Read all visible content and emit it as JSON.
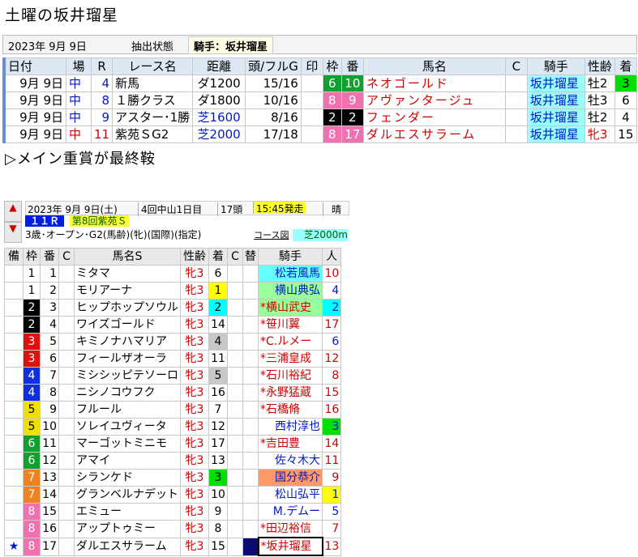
{
  "page_title": "土曜の坂井瑠星",
  "subtitle": "▷メイン重賞が最終鞍",
  "filter": {
    "date": "2023年 9月 9日",
    "label": "抽出状態",
    "condition": "騎手：坂井瑠星"
  },
  "summary": {
    "headers": [
      "日付",
      "場",
      "R",
      "レース名",
      "距離",
      "頭/フルG",
      "印",
      "枠",
      "番",
      "馬名",
      "C",
      "騎手",
      "性齢",
      "着"
    ],
    "rows": [
      {
        "date": "9月 9日",
        "place": "中",
        "r": "4",
        "race": "新馬",
        "dist": "ダ1200",
        "heads": "15/16",
        "mark": "",
        "waku": "6",
        "ban": "10",
        "horse": "ネオゴールド",
        "c": "",
        "jockey": "坂井瑠星",
        "sex": "牡2",
        "finish": "3"
      },
      {
        "date": "9月 9日",
        "place": "中",
        "r": "8",
        "race": "１勝クラス",
        "dist": "ダ1800",
        "heads": "10/16",
        "mark": "",
        "waku": "8",
        "ban": "9",
        "horse": "アヴァンタージュ",
        "c": "",
        "jockey": "坂井瑠星",
        "sex": "牡3",
        "finish": "6"
      },
      {
        "date": "9月 9日",
        "place": "中",
        "r": "9",
        "race": "アスター･1勝",
        "dist": "芝1600",
        "heads": "8/16",
        "mark": "",
        "waku": "2",
        "ban": "2",
        "horse": "フェンダー",
        "c": "",
        "jockey": "坂井瑠星",
        "sex": "牡2",
        "finish": "4"
      },
      {
        "date": "9月 9日",
        "place": "中",
        "r": "11",
        "race": "紫苑ＳG2",
        "dist": "芝2000",
        "heads": "17/18",
        "mark": "",
        "waku": "8",
        "ban": "17",
        "horse": "ダルエスサラーム",
        "c": "",
        "jockey": "坂井瑠星",
        "sex": "牝3",
        "finish": "15"
      }
    ]
  },
  "racecard": {
    "date": "2023年 9月 9日(土)",
    "kaisai": "4回中山1日目",
    "heads": "17頭",
    "start": "15:45発走",
    "weather": "晴",
    "race_no": "１１Ｒ",
    "race_name": "第8回紫苑Ｓ",
    "condition": "3歳･オープン･G2(馬齢)(牝)(国際)(指定)",
    "course_link": "コース図",
    "course": "芝2000m",
    "headers": [
      "備",
      "枠",
      "番",
      "C",
      "馬名S",
      "性齢",
      "着",
      "C",
      "替",
      "騎手",
      "人"
    ],
    "rows": [
      {
        "mark": "",
        "waku": "1",
        "ban": "1",
        "horse": "ミタマ",
        "sex": "牝3",
        "finish": "6",
        "jockey": "松若風馬",
        "change": "",
        "pop": "10"
      },
      {
        "mark": "",
        "waku": "1",
        "ban": "2",
        "horse": "モリアーナ",
        "sex": "牝3",
        "finish": "1",
        "jockey": "横山典弘",
        "change": "",
        "pop": "4"
      },
      {
        "mark": "",
        "waku": "2",
        "ban": "3",
        "horse": "ヒップホップソウル",
        "sex": "牝3",
        "finish": "2",
        "jockey": "横山武史",
        "change": "*",
        "pop": "2"
      },
      {
        "mark": "",
        "waku": "2",
        "ban": "4",
        "horse": "ワイズゴールド",
        "sex": "牝3",
        "finish": "14",
        "jockey": "笹川翼",
        "change": "*",
        "pop": "17"
      },
      {
        "mark": "",
        "waku": "3",
        "ban": "5",
        "horse": "キミノナハマリア",
        "sex": "牝3",
        "finish": "4",
        "jockey": "C.ルメー",
        "change": "*",
        "pop": "6"
      },
      {
        "mark": "",
        "waku": "3",
        "ban": "6",
        "horse": "フィールザオーラ",
        "sex": "牝3",
        "finish": "11",
        "jockey": "三浦皇成",
        "change": "*",
        "pop": "12"
      },
      {
        "mark": "",
        "waku": "4",
        "ban": "7",
        "horse": "ミシシッピテソーロ",
        "sex": "牝3",
        "finish": "5",
        "jockey": "石川裕紀",
        "change": "*",
        "pop": "8"
      },
      {
        "mark": "",
        "waku": "4",
        "ban": "8",
        "horse": "ニシノコウフク",
        "sex": "牝3",
        "finish": "16",
        "jockey": "永野猛蔵",
        "change": "*",
        "pop": "15"
      },
      {
        "mark": "",
        "waku": "5",
        "ban": "9",
        "horse": "フルール",
        "sex": "牝3",
        "finish": "7",
        "jockey": "石橋脩",
        "change": "*",
        "pop": "16"
      },
      {
        "mark": "",
        "waku": "5",
        "ban": "10",
        "horse": "ソレイユヴィータ",
        "sex": "牝3",
        "finish": "12",
        "jockey": "西村淳也",
        "change": "",
        "pop": "3"
      },
      {
        "mark": "",
        "waku": "6",
        "ban": "11",
        "horse": "マーゴットミニモ",
        "sex": "牝3",
        "finish": "17",
        "jockey": "吉田豊",
        "change": "*",
        "pop": "14"
      },
      {
        "mark": "",
        "waku": "6",
        "ban": "12",
        "horse": "アマイ",
        "sex": "牝3",
        "finish": "13",
        "jockey": "佐々木大",
        "change": "",
        "pop": "11"
      },
      {
        "mark": "",
        "waku": "7",
        "ban": "13",
        "horse": "シランケド",
        "sex": "牝3",
        "finish": "3",
        "jockey": "国分恭介",
        "change": "",
        "pop": "9"
      },
      {
        "mark": "",
        "waku": "7",
        "ban": "14",
        "horse": "グランベルナデット",
        "sex": "牝3",
        "finish": "10",
        "jockey": "松山弘平",
        "change": "",
        "pop": "1"
      },
      {
        "mark": "",
        "waku": "8",
        "ban": "15",
        "horse": "エミュー",
        "sex": "牝3",
        "finish": "9",
        "jockey": "M.デムー",
        "change": "",
        "pop": "5"
      },
      {
        "mark": "",
        "waku": "8",
        "ban": "16",
        "horse": "アップトゥミー",
        "sex": "牝3",
        "finish": "8",
        "jockey": "田辺裕信",
        "change": "*",
        "pop": "7"
      },
      {
        "mark": "★",
        "waku": "8",
        "ban": "17",
        "horse": "ダルエスサラーム",
        "sex": "牝3",
        "finish": "15",
        "jockey": "坂井瑠星",
        "change": "*",
        "pop": "13"
      }
    ]
  },
  "colors": {
    "blue_text": "#0018c8",
    "red_text": "#d00000",
    "jockey_bg": "#99ffff",
    "gold": "#ffff00",
    "silver": "#00ffff",
    "bronze": "#00e000"
  }
}
